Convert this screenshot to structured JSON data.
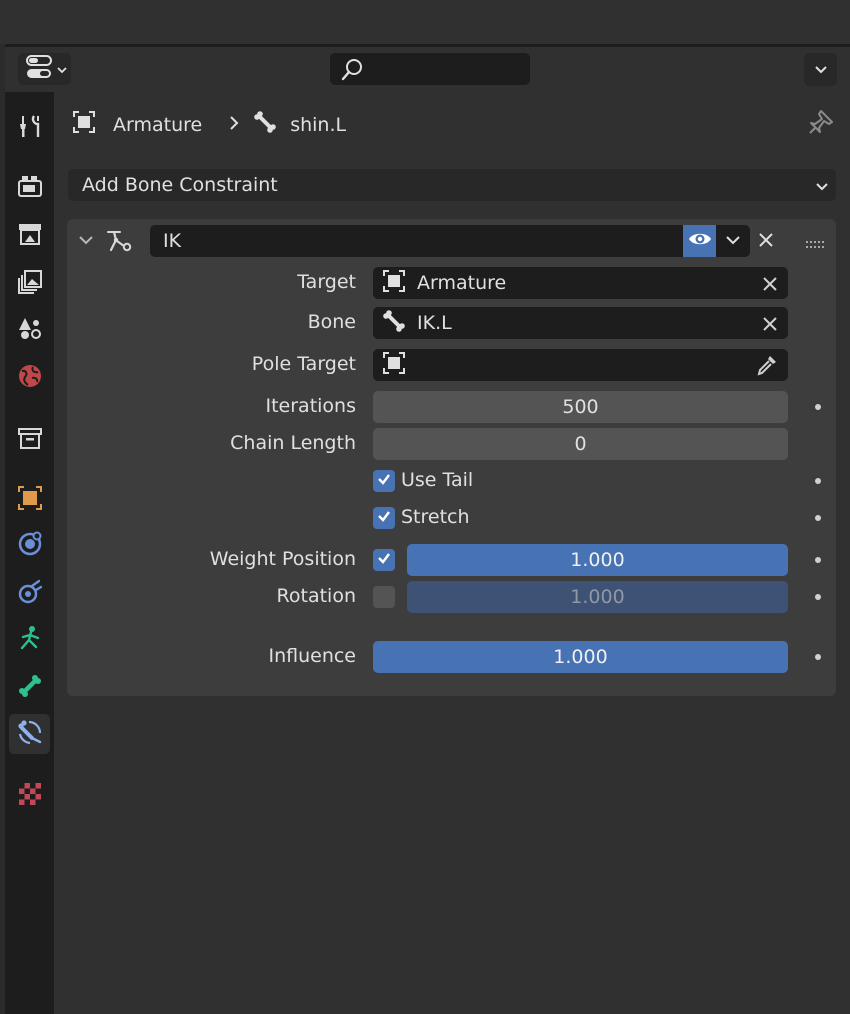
{
  "header": {
    "search": {
      "placeholder": ""
    }
  },
  "tabs": [
    {
      "id": "tool",
      "icon": "tool-icon"
    },
    {
      "id": "render",
      "icon": "render-icon"
    },
    {
      "id": "output",
      "icon": "output-icon"
    },
    {
      "id": "view-layer",
      "icon": "view-layer-icon"
    },
    {
      "id": "scene",
      "icon": "scene-icon"
    },
    {
      "id": "world",
      "icon": "world-icon"
    },
    {
      "id": "collection",
      "icon": "collection-icon"
    },
    {
      "id": "object",
      "icon": "object-icon"
    },
    {
      "id": "modifiers",
      "icon": "modifiers-icon"
    },
    {
      "id": "physics",
      "icon": "physics-icon"
    },
    {
      "id": "object-data",
      "icon": "armature-data-icon"
    },
    {
      "id": "bone",
      "icon": "bone-icon"
    },
    {
      "id": "bone-constraints",
      "icon": "bone-constraint-icon",
      "active": true
    },
    {
      "id": "texture",
      "icon": "texture-icon"
    }
  ],
  "breadcrumb": {
    "object": "Armature",
    "separator": ">",
    "bone": "shin.L"
  },
  "add_constraint": {
    "label": "Add Bone Constraint"
  },
  "constraint": {
    "name": "IK",
    "visible": true,
    "fields": {
      "target": {
        "label": "Target",
        "value": "Armature"
      },
      "bone": {
        "label": "Bone",
        "value": "IK.L"
      },
      "pole_target": {
        "label": "Pole Target",
        "value": ""
      },
      "iterations": {
        "label": "Iterations",
        "value": "500"
      },
      "chain_length": {
        "label": "Chain Length",
        "value": "0"
      },
      "use_tail": {
        "label": "Use Tail",
        "checked": true
      },
      "stretch": {
        "label": "Stretch",
        "checked": true
      },
      "weight_position": {
        "label": "Weight Position",
        "checked": true,
        "value": "1.000"
      },
      "rotation": {
        "label": "Rotation",
        "checked": false,
        "value": "1.000"
      },
      "influence": {
        "label": "Influence",
        "value": "1.000"
      }
    }
  },
  "colors": {
    "accent": "#4772b3",
    "background": "#303030",
    "panel": "#3d3d3d",
    "field": "#1d1d1d"
  }
}
